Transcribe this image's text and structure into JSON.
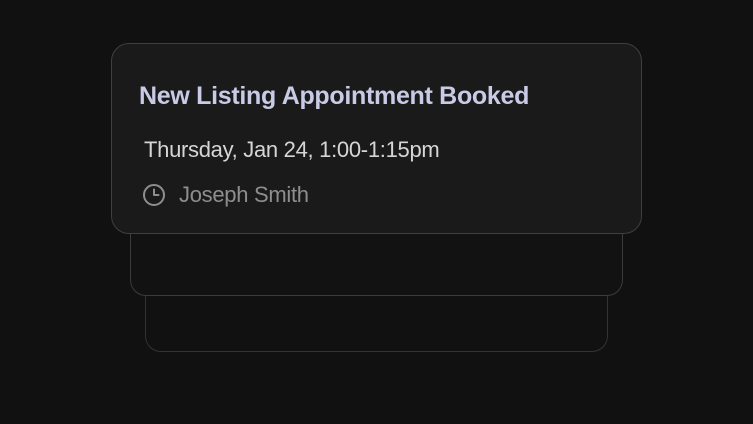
{
  "notification": {
    "title": "New Listing Appointment Booked",
    "datetime": "Thursday, Jan 24, 1:00-1:15pm",
    "agent_name": "Joseph Smith",
    "agent_icon": "clock-icon"
  },
  "colors": {
    "background": "#111111",
    "card_background": "#1a1a1a",
    "card_border": "#3f3f3f",
    "title": "#c9cbe6",
    "datetime": "#d6d6d6",
    "secondary_text": "#8e8e8e"
  }
}
